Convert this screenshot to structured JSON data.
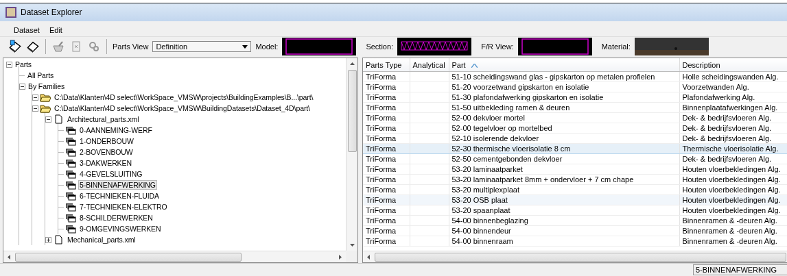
{
  "window": {
    "title": "Dataset Explorer"
  },
  "menu": [
    {
      "label": "Dataset"
    },
    {
      "label": "Edit"
    }
  ],
  "toolbar": {
    "parts_view_label": "Parts View",
    "parts_view_value": "Definition",
    "previews": [
      {
        "label": "Model:",
        "kind": "model"
      },
      {
        "label": "Section:",
        "kind": "section"
      },
      {
        "label": "F/R View:",
        "kind": "model"
      },
      {
        "label": "Material:",
        "kind": "material"
      }
    ]
  },
  "tree": [
    {
      "label": "Parts",
      "expanded": true,
      "selected": false,
      "children": [
        {
          "label": "All Parts",
          "selected": false
        },
        {
          "label": "By Families",
          "expanded": true,
          "selected": false,
          "children": [
            {
              "label": "C:\\Data\\Klanten\\4D select\\WorkSpace_VMSW\\projects\\BuildingExamples\\B...\\part\\",
              "kind": "folder",
              "expanded": true,
              "selected": false
            },
            {
              "label": "C:\\Data\\Klanten\\4D select\\WorkSpace_VMSW\\BuildingDatasets\\Dataset_4D\\part\\",
              "kind": "folder",
              "expanded": true,
              "selected": false,
              "children": [
                {
                  "label": "Architectural_parts.xml",
                  "kind": "file",
                  "expanded": true,
                  "selected": false,
                  "children": [
                    {
                      "label": "0-AANNEMING-WERF",
                      "kind": "group",
                      "selected": false
                    },
                    {
                      "label": "1-ONDERBOUW",
                      "kind": "group",
                      "selected": false
                    },
                    {
                      "label": "2-BOVENBOUW",
                      "kind": "group",
                      "selected": false
                    },
                    {
                      "label": "3-DAKWERKEN",
                      "kind": "group",
                      "selected": false
                    },
                    {
                      "label": "4-GEVELSLUITING",
                      "kind": "group",
                      "selected": false
                    },
                    {
                      "label": "5-BINNENAFWERKING",
                      "kind": "group",
                      "selected": true
                    },
                    {
                      "label": "6-TECHNIEKEN-FLUIDA",
                      "kind": "group",
                      "selected": false
                    },
                    {
                      "label": "7-TECHNIEKEN-ELEKTRO",
                      "kind": "group",
                      "selected": false
                    },
                    {
                      "label": "8-SCHILDERWERKEN",
                      "kind": "group",
                      "selected": false
                    },
                    {
                      "label": "9-OMGEVINGSWERKEN",
                      "kind": "group",
                      "selected": false
                    }
                  ]
                },
                {
                  "label": "Mechanical_parts.xml",
                  "kind": "file",
                  "expanded": false,
                  "selected": false
                }
              ]
            }
          ]
        }
      ]
    }
  ],
  "table": {
    "columns": [
      {
        "label": "Parts Type",
        "sorted": false
      },
      {
        "label": "Analytical",
        "sorted": false
      },
      {
        "label": "Part",
        "sorted": true
      },
      {
        "label": "Description",
        "sorted": false
      }
    ],
    "rows": [
      {
        "type": "TriForma",
        "part": "51-10 scheidingswand glas - gipskarton op metalen profielen",
        "description": "Holle scheidingswanden Alg.",
        "selected": false,
        "hovered": false
      },
      {
        "type": "TriForma",
        "part": "51-20 voorzetwand gipskarton en isolatie",
        "description": "Voorzetwanden Alg.",
        "selected": false,
        "hovered": false
      },
      {
        "type": "TriForma",
        "part": "51-30 plafondafwerking gipskarton en isolatie",
        "description": "Plafondafwerking Alg.",
        "selected": false,
        "hovered": false
      },
      {
        "type": "TriForma",
        "part": "51-50 uitbekleding ramen & deuren",
        "description": "Binnenplaatafwerkingen Alg.",
        "selected": false,
        "hovered": false
      },
      {
        "type": "TriForma",
        "part": "52-00 dekvloer mortel",
        "description": "Dek- & bedrijfsvloeren Alg.",
        "selected": false,
        "hovered": false
      },
      {
        "type": "TriForma",
        "part": "52-00 tegelvloer op mortelbed",
        "description": "Dek- & bedrijfsvloeren Alg.",
        "selected": false,
        "hovered": false
      },
      {
        "type": "TriForma",
        "part": "52-10 isolerende dekvloer",
        "description": "Dek- & bedrijfsvloeren Alg.",
        "selected": false,
        "hovered": false
      },
      {
        "type": "TriForma",
        "part": "52-30 thermische vloerisolatie 8 cm",
        "description": "Thermische vloerisolatie Alg.",
        "selected": true,
        "hovered": false
      },
      {
        "type": "TriForma",
        "part": "52-50 cementgebonden dekvloer",
        "description": "Dek- & bedrijfsvloeren Alg.",
        "selected": false,
        "hovered": false
      },
      {
        "type": "TriForma",
        "part": "53-20 laminaatparket",
        "description": "Houten vloerbekledingen Alg.",
        "selected": false,
        "hovered": false
      },
      {
        "type": "TriForma",
        "part": "53-20 laminaatparket 8mm + ondervloer + 7 cm chape",
        "description": "Houten vloerbekledingen Alg.",
        "selected": false,
        "hovered": false
      },
      {
        "type": "TriForma",
        "part": "53-20 multiplexplaat",
        "description": "Houten vloerbekledingen Alg.",
        "selected": false,
        "hovered": false
      },
      {
        "type": "TriForma",
        "part": "53-20 OSB plaat",
        "description": "Houten vloerbekledingen Alg.",
        "selected": false,
        "hovered": true
      },
      {
        "type": "TriForma",
        "part": "53-20 spaanplaat",
        "description": "Houten vloerbekledingen Alg.",
        "selected": false,
        "hovered": false
      },
      {
        "type": "TriForma",
        "part": "54-00 binnenbeglazing",
        "description": "Binnenramen & -deuren Alg.",
        "selected": false,
        "hovered": false
      },
      {
        "type": "TriForma",
        "part": "54-00 binnendeur",
        "description": "Binnenramen & -deuren Alg.",
        "selected": false,
        "hovered": false
      },
      {
        "type": "TriForma",
        "part": "54-00 binnenraam",
        "description": "Binnenramen & -deuren Alg.",
        "selected": false,
        "hovered": false
      }
    ]
  },
  "status_bar": {
    "text": "5-BINNENAFWERKING"
  }
}
